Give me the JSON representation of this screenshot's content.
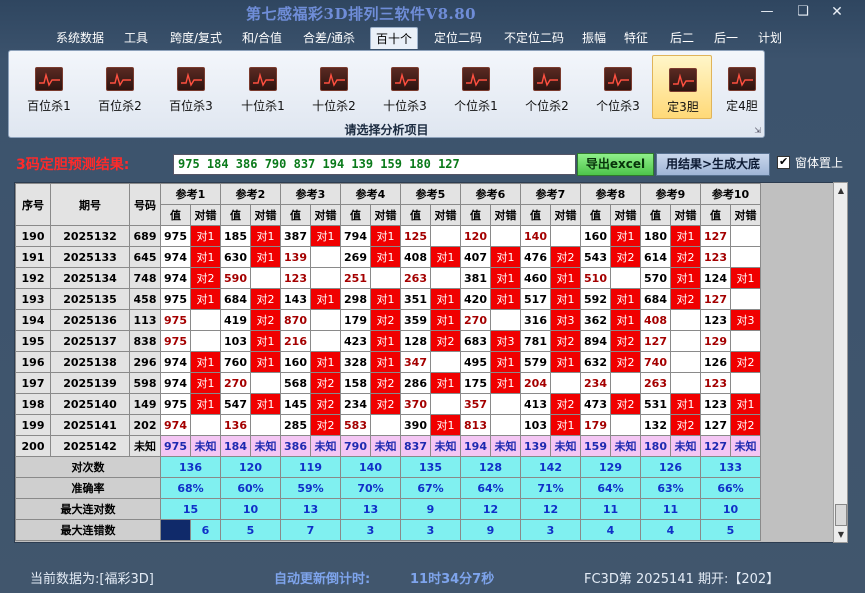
{
  "app": {
    "title": "第七感福彩3D排列三软件V8.80"
  },
  "window": {
    "min_icon": "minimize-icon",
    "max_icon": "maximize-icon",
    "close_icon": "close-icon"
  },
  "menu": [
    "系统数据",
    "工具",
    "跨度/复式",
    "和/合值",
    "合差/通杀",
    "百十个",
    "定位二码",
    "不定位二码",
    "振幅",
    "特征",
    "后二",
    "后一",
    "计划"
  ],
  "menu_active": "百十个",
  "ribbon": {
    "buttons": [
      "百位杀1",
      "百位杀2",
      "百位杀3",
      "十位杀1",
      "十位杀2",
      "十位杀3",
      "个位杀1",
      "个位杀2",
      "个位杀3",
      "定3胆",
      "定4胆"
    ],
    "selected": "定3胆",
    "caption": "请选择分析项目"
  },
  "prediction": {
    "label": "3码定胆预测结果:",
    "value": "975 184 386 790 837 194 139 159 180 127",
    "export_label": "导出excel",
    "generate_label": "用结果>生成大底",
    "ontop_label": "窗体置上",
    "ontop_checked": true
  },
  "table": {
    "headers": {
      "seq": "序号",
      "issue": "期号",
      "number": "号码",
      "value": "值",
      "check": "对错"
    },
    "refs": [
      "参考1",
      "参考2",
      "参考3",
      "参考4",
      "参考5",
      "参考6",
      "参考7",
      "参考8",
      "参考9",
      "参考10"
    ],
    "rows": [
      {
        "seq": "190",
        "issue": "2025132",
        "num": "689",
        "cells": [
          [
            "975",
            "对1"
          ],
          [
            "185",
            "对1"
          ],
          [
            "387",
            "对1"
          ],
          [
            "794",
            "对1"
          ],
          [
            "125",
            ""
          ],
          [
            "120",
            ""
          ],
          [
            "140",
            ""
          ],
          [
            "160",
            "对1"
          ],
          [
            "180",
            "对1"
          ],
          [
            "127",
            ""
          ]
        ]
      },
      {
        "seq": "191",
        "issue": "2025133",
        "num": "645",
        "cells": [
          [
            "974",
            "对1"
          ],
          [
            "630",
            "对1"
          ],
          [
            "139",
            ""
          ],
          [
            "269",
            "对1"
          ],
          [
            "408",
            "对1"
          ],
          [
            "407",
            "对1"
          ],
          [
            "476",
            "对2"
          ],
          [
            "543",
            "对2"
          ],
          [
            "614",
            "对2"
          ],
          [
            "123",
            ""
          ]
        ]
      },
      {
        "seq": "192",
        "issue": "2025134",
        "num": "748",
        "cells": [
          [
            "974",
            "对2"
          ],
          [
            "590",
            ""
          ],
          [
            "123",
            ""
          ],
          [
            "251",
            ""
          ],
          [
            "263",
            ""
          ],
          [
            "381",
            "对1"
          ],
          [
            "460",
            "对1"
          ],
          [
            "510",
            ""
          ],
          [
            "570",
            "对1"
          ],
          [
            "124",
            "对1"
          ]
        ]
      },
      {
        "seq": "193",
        "issue": "2025135",
        "num": "458",
        "cells": [
          [
            "975",
            "对1"
          ],
          [
            "684",
            "对2"
          ],
          [
            "143",
            "对1"
          ],
          [
            "298",
            "对1"
          ],
          [
            "351",
            "对1"
          ],
          [
            "420",
            "对1"
          ],
          [
            "517",
            "对1"
          ],
          [
            "592",
            "对1"
          ],
          [
            "684",
            "对2"
          ],
          [
            "127",
            ""
          ]
        ]
      },
      {
        "seq": "194",
        "issue": "2025136",
        "num": "113",
        "cells": [
          [
            "975",
            ""
          ],
          [
            "419",
            "对2"
          ],
          [
            "870",
            ""
          ],
          [
            "179",
            "对2"
          ],
          [
            "359",
            "对1"
          ],
          [
            "270",
            ""
          ],
          [
            "316",
            "对3"
          ],
          [
            "362",
            "对1"
          ],
          [
            "408",
            ""
          ],
          [
            "123",
            "对3"
          ]
        ]
      },
      {
        "seq": "195",
        "issue": "2025137",
        "num": "838",
        "cells": [
          [
            "975",
            ""
          ],
          [
            "103",
            "对1"
          ],
          [
            "216",
            ""
          ],
          [
            "423",
            "对1"
          ],
          [
            "128",
            "对2"
          ],
          [
            "683",
            "对3"
          ],
          [
            "781",
            "对2"
          ],
          [
            "894",
            "对2"
          ],
          [
            "127",
            ""
          ],
          [
            "129",
            ""
          ]
        ]
      },
      {
        "seq": "196",
        "issue": "2025138",
        "num": "296",
        "cells": [
          [
            "974",
            "对1"
          ],
          [
            "760",
            "对1"
          ],
          [
            "160",
            "对1"
          ],
          [
            "328",
            "对1"
          ],
          [
            "347",
            ""
          ],
          [
            "495",
            "对1"
          ],
          [
            "579",
            "对1"
          ],
          [
            "632",
            "对2"
          ],
          [
            "740",
            ""
          ],
          [
            "126",
            "对2"
          ]
        ]
      },
      {
        "seq": "197",
        "issue": "2025139",
        "num": "598",
        "cells": [
          [
            "974",
            "对1"
          ],
          [
            "270",
            ""
          ],
          [
            "568",
            "对2"
          ],
          [
            "158",
            "对2"
          ],
          [
            "286",
            "对1"
          ],
          [
            "175",
            "对1"
          ],
          [
            "204",
            ""
          ],
          [
            "234",
            ""
          ],
          [
            "263",
            ""
          ],
          [
            "123",
            ""
          ]
        ]
      },
      {
        "seq": "198",
        "issue": "2025140",
        "num": "149",
        "cells": [
          [
            "975",
            "对1"
          ],
          [
            "547",
            "对1"
          ],
          [
            "145",
            "对2"
          ],
          [
            "234",
            "对2"
          ],
          [
            "370",
            ""
          ],
          [
            "357",
            ""
          ],
          [
            "413",
            "对2"
          ],
          [
            "473",
            "对2"
          ],
          [
            "531",
            "对1"
          ],
          [
            "123",
            "对1"
          ]
        ]
      },
      {
        "seq": "199",
        "issue": "2025141",
        "num": "202",
        "cells": [
          [
            "974",
            ""
          ],
          [
            "136",
            ""
          ],
          [
            "285",
            "对2"
          ],
          [
            "583",
            ""
          ],
          [
            "390",
            "对1"
          ],
          [
            "813",
            ""
          ],
          [
            "103",
            "对1"
          ],
          [
            "179",
            ""
          ],
          [
            "132",
            "对2"
          ],
          [
            "127",
            "对2"
          ]
        ]
      }
    ],
    "unknown_row": {
      "seq": "200",
      "issue": "2025142",
      "num": "未知",
      "cells": [
        [
          "975",
          "未知"
        ],
        [
          "184",
          "未知"
        ],
        [
          "386",
          "未知"
        ],
        [
          "790",
          "未知"
        ],
        [
          "837",
          "未知"
        ],
        [
          "194",
          "未知"
        ],
        [
          "139",
          "未知"
        ],
        [
          "159",
          "未知"
        ],
        [
          "180",
          "未知"
        ],
        [
          "127",
          "未知"
        ]
      ]
    },
    "stats": [
      {
        "label": "对次数",
        "values": [
          "136",
          "120",
          "119",
          "140",
          "135",
          "128",
          "142",
          "129",
          "126",
          "133"
        ]
      },
      {
        "label": "准确率",
        "values": [
          "68%",
          "60%",
          "59%",
          "70%",
          "67%",
          "64%",
          "71%",
          "64%",
          "63%",
          "66%"
        ]
      },
      {
        "label": "最大连对数",
        "values": [
          "15",
          "10",
          "13",
          "13",
          "9",
          "12",
          "12",
          "11",
          "11",
          "10"
        ]
      },
      {
        "label": "最大连错数",
        "values": [
          "6",
          "5",
          "7",
          "3",
          "3",
          "9",
          "3",
          "4",
          "4",
          "5"
        ]
      }
    ]
  },
  "status": {
    "current": "当前数据为:[福彩3D]",
    "countdown_label": "自动更新倒计时:",
    "countdown": "11时34分7秒",
    "issue": "FC3D第 2025141 期开:【202】"
  },
  "colors": {
    "hit": "#f00000",
    "stat_bg": "#80f0f0",
    "unknown_bg": "#f4c6f4",
    "pred_text": "#0a7a1a",
    "title": "#6f8dd8"
  }
}
